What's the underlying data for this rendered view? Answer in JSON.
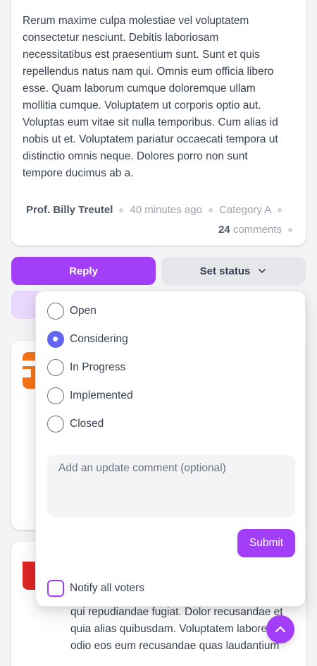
{
  "post": {
    "body": "Rerum maxime culpa molestiae vel voluptatem consectetur nesciunt. Debitis laboriosam necessitatibus est praesentium sunt. Sunt et quis repellendus natus nam qui. Omnis eum officia libero esse. Quam laborum cumque doloremque ullam mollitia cumque. Voluptatem ut corporis optio aut. Voluptas eum vitae sit nulla temporibus. Cum alias id nobis ut et. Voluptatem pariatur occaecati tempora ut distinctio omnis neque. Dolores porro non sunt tempore ducimus ab a.",
    "author": "Prof. Billy Treutel",
    "time": "40 minutes ago",
    "category": "Category A",
    "comment_count": "24",
    "comments_label": "comments"
  },
  "actions": {
    "reply_label": "Reply",
    "set_status_label": "Set status"
  },
  "status_dropdown": {
    "options": [
      {
        "label": "Open",
        "checked": false
      },
      {
        "label": "Considering",
        "checked": true
      },
      {
        "label": "In Progress",
        "checked": false
      },
      {
        "label": "Implemented",
        "checked": false
      },
      {
        "label": "Closed",
        "checked": false
      }
    ],
    "comment_placeholder": "Add an update comment (optional)",
    "submit_label": "Submit",
    "notify_label": "Notify all voters"
  },
  "card3": {
    "body_fragment": "qui repudiandae fugiat. Dolor recusandae et quia alias quibusdam. Voluptatem labore quis odio eos eum recusandae quas laudantium"
  },
  "colors": {
    "accent": "#a33ef8",
    "radio_checked": "#6366f1"
  }
}
